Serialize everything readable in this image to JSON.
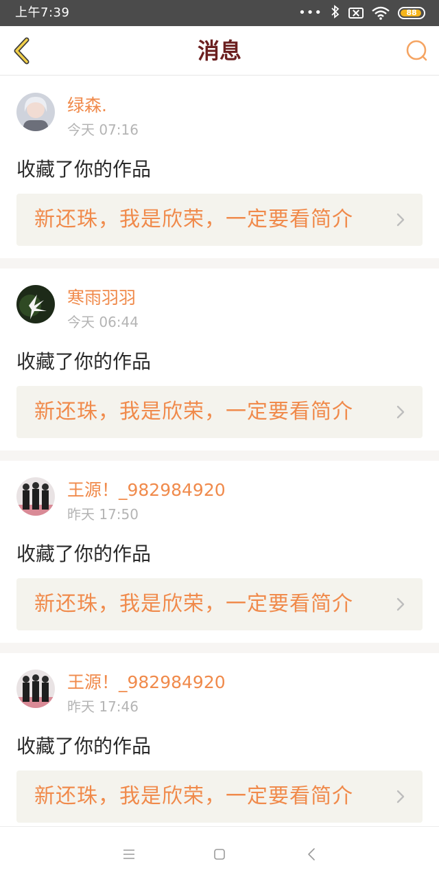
{
  "status_bar": {
    "time": "上午7:39",
    "battery": "88",
    "icons": [
      "dots-icon",
      "bluetooth-icon",
      "no-sim-icon",
      "wifi-icon",
      "battery-icon"
    ]
  },
  "header": {
    "title": "消息",
    "back_icon": "chevron-left-icon",
    "search_icon": "search-icon",
    "accent": "#f5a462",
    "title_color": "#6b1f1f"
  },
  "messages": [
    {
      "username": "绿森.",
      "time": "今天 07:16",
      "action": "收藏了你的作品",
      "work_title": "新还珠，我是欣荣，一定要看简介"
    },
    {
      "username": "寒雨羽羽",
      "time": "今天 06:44",
      "action": "收藏了你的作品",
      "work_title": "新还珠，我是欣荣，一定要看简介"
    },
    {
      "username": "王源！_982984920",
      "time": "昨天 17:50",
      "action": "收藏了你的作品",
      "work_title": "新还珠，我是欣荣，一定要看简介"
    },
    {
      "username": "王源！_982984920",
      "time": "昨天 17:46",
      "action": "收藏了你的作品",
      "work_title": "新还珠，我是欣荣，一定要看简介"
    }
  ],
  "colors": {
    "username": "#f08a4b",
    "card_bg": "#f4f3ed",
    "timestamp": "#b4b4b4"
  },
  "nav_bar": {
    "icons": [
      "menu-icon",
      "home-square-icon",
      "back-triangle-icon"
    ]
  }
}
